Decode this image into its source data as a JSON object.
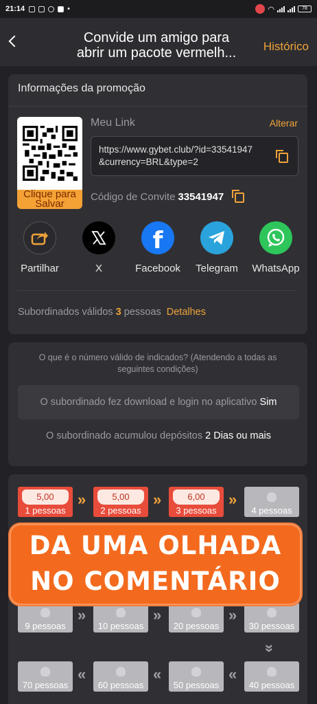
{
  "status_bar": {
    "time": "21:14",
    "battery": "78"
  },
  "header": {
    "title_line1": "Convide um amigo para",
    "title_line2": "abrir um pacote vermelh...",
    "history_label": "Histórico"
  },
  "promo": {
    "section_title": "Informações da promoção",
    "qr_save_line1": "Clique para",
    "qr_save_line2": "Salvar",
    "my_link_label": "Meu Link",
    "change_label": "Alterar",
    "link_line1": "https://www.gybet.club/?id=33541947",
    "link_line2": "&currency=BRL&type=2",
    "invite_code_label": "Código de Convite",
    "invite_code": "33541947",
    "share": [
      {
        "label": "Partilhar",
        "icon": "share-icon"
      },
      {
        "label": "X",
        "icon": "x-logo-icon"
      },
      {
        "label": "Facebook",
        "icon": "facebook-icon"
      },
      {
        "label": "Telegram",
        "icon": "telegram-icon"
      },
      {
        "label": "WhatsApp",
        "icon": "whatsapp-icon"
      }
    ],
    "valid_subs_label": "Subordinados válidos",
    "valid_subs_count": "3",
    "valid_subs_unit": "pessoas",
    "details_label": "Detalhes"
  },
  "conditions": {
    "question": "O que é o número válido de indicados? (Atendendo a todas as seguintes condições)",
    "cond1_text": "O subordinado fez download e login no aplicativo",
    "cond1_value": "Sim",
    "cond2_text": "O subordinado acumulou depósitos",
    "cond2_value": "2 Dias ou mais"
  },
  "rewards": {
    "row1": [
      {
        "amount": "5,00",
        "label": "1 pessoas",
        "opened": true
      },
      {
        "amount": "5,00",
        "label": "2 pessoas",
        "opened": true
      },
      {
        "amount": "6,00",
        "label": "3 pessoas",
        "opened": true
      },
      {
        "amount": "",
        "label": "4 pessoas",
        "opened": false
      }
    ],
    "row3": [
      {
        "label": "9 pessoas"
      },
      {
        "label": "10 pessoas"
      },
      {
        "label": "20 pessoas"
      },
      {
        "label": "30 pessoas"
      }
    ],
    "row4": [
      {
        "label": "70 pessoas"
      },
      {
        "label": "60 pessoas"
      },
      {
        "label": "50 pessoas"
      },
      {
        "label": "40 pessoas"
      }
    ]
  },
  "overlay": {
    "line1": "DA UMA OLHADA",
    "line2": "NO COMENTÁRIO"
  },
  "colors": {
    "accent": "#f0a33a",
    "banner": "#f36a1e",
    "card": "#303034",
    "background": "#222226"
  }
}
